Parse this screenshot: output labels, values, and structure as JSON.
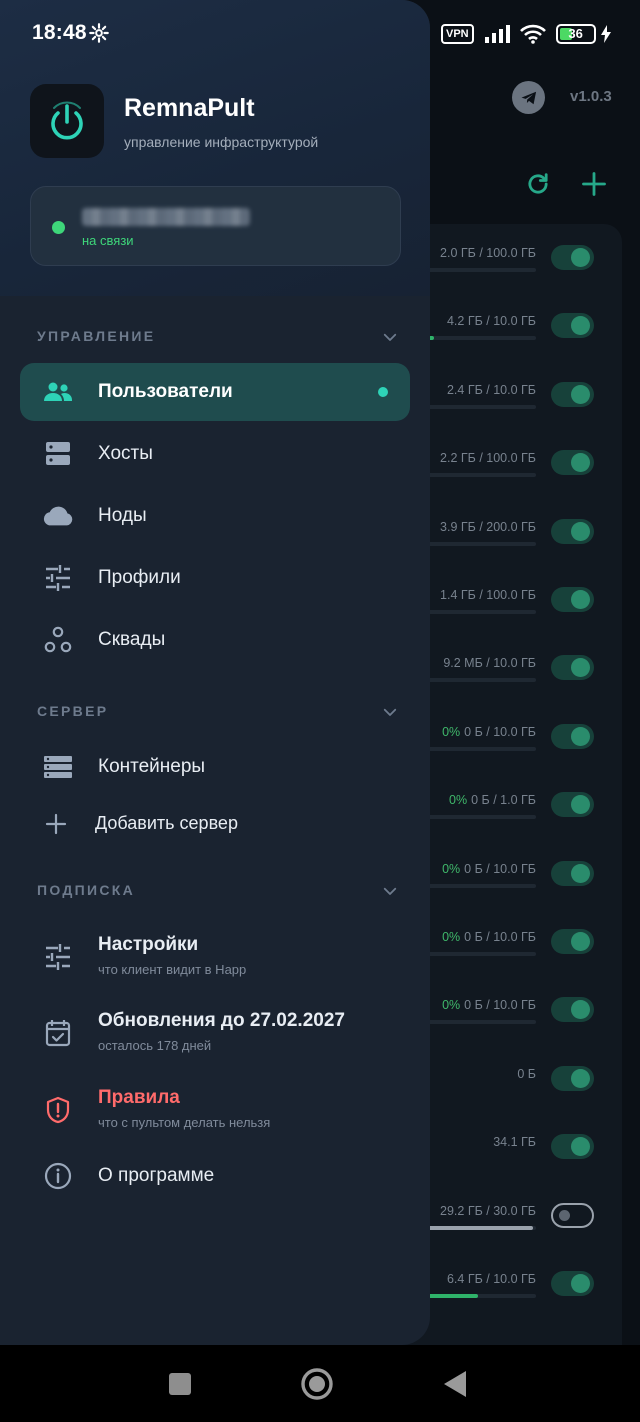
{
  "status_bar": {
    "time": "18:48",
    "vpn": "VPN",
    "battery_level": "36"
  },
  "background_app": {
    "version": "v1.0.3",
    "rows": [
      {
        "usage": "2.0 ГБ / 100.0 ГБ",
        "pct": "",
        "bar": 0.02,
        "enabled": true
      },
      {
        "usage": "4.2 ГБ / 10.0 ГБ",
        "pct": "",
        "bar": 0.12,
        "enabled": true
      },
      {
        "usage": "2.4 ГБ / 10.0 ГБ",
        "pct": "",
        "bar": 0,
        "enabled": true
      },
      {
        "usage": "2.2 ГБ / 100.0 ГБ",
        "pct": "",
        "bar": 0,
        "enabled": true
      },
      {
        "usage": "3.9 ГБ / 200.0 ГБ",
        "pct": "",
        "bar": 0,
        "enabled": true
      },
      {
        "usage": "1.4 ГБ / 100.0 ГБ",
        "pct": "",
        "bar": 0,
        "enabled": true
      },
      {
        "usage": "9.2 МБ / 10.0 ГБ",
        "pct": "",
        "bar": 0,
        "enabled": true
      },
      {
        "usage": "0 Б / 10.0 ГБ",
        "pct": "0%",
        "bar": 0,
        "enabled": true
      },
      {
        "usage": "0 Б / 1.0 ГБ",
        "pct": "0%",
        "bar": 0,
        "enabled": true
      },
      {
        "usage": "0 Б / 10.0 ГБ",
        "pct": "0%",
        "bar": 0,
        "enabled": true
      },
      {
        "usage": "0 Б / 10.0 ГБ",
        "pct": "0%",
        "bar": 0,
        "enabled": true
      },
      {
        "usage": "0 Б / 10.0 ГБ",
        "pct": "0%",
        "bar": 0,
        "enabled": true
      },
      {
        "usage": "0 Б",
        "pct": "",
        "bar": 0,
        "enabled": true
      },
      {
        "usage": "34.1 ГБ",
        "pct": "",
        "bar": 0,
        "enabled": true
      },
      {
        "usage": "29.2 ГБ / 30.0 ГБ",
        "pct": "",
        "bar": 0.97,
        "enabled": false
      },
      {
        "usage": "6.4 ГБ / 10.0 ГБ",
        "pct": "",
        "bar": 0.5,
        "enabled": true
      }
    ]
  },
  "drawer": {
    "app_name": "RemnaPult",
    "app_subtitle": "управление инфраструктурой",
    "server": {
      "status": "на связи"
    },
    "sections": {
      "management": "УПРАВЛЕНИЕ",
      "server": "СЕРВЕР",
      "subscription": "ПОДПИСКА"
    },
    "items": {
      "users": "Пользователи",
      "hosts": "Хосты",
      "nodes": "Ноды",
      "profiles": "Профили",
      "squads": "Сквады",
      "containers": "Контейнеры",
      "add_server": "Добавить сервер",
      "settings": "Настройки",
      "settings_sub": "что клиент видит в Happ",
      "updates": "Обновления до 27.02.2027",
      "updates_sub": "осталось 178 дней",
      "rules": "Правила",
      "rules_sub": "что с пультом делать нельзя",
      "about": "О программе"
    },
    "colors": {
      "accent": "#2ed3b7",
      "online": "#3ed67a",
      "danger": "#ff6b6b"
    }
  }
}
